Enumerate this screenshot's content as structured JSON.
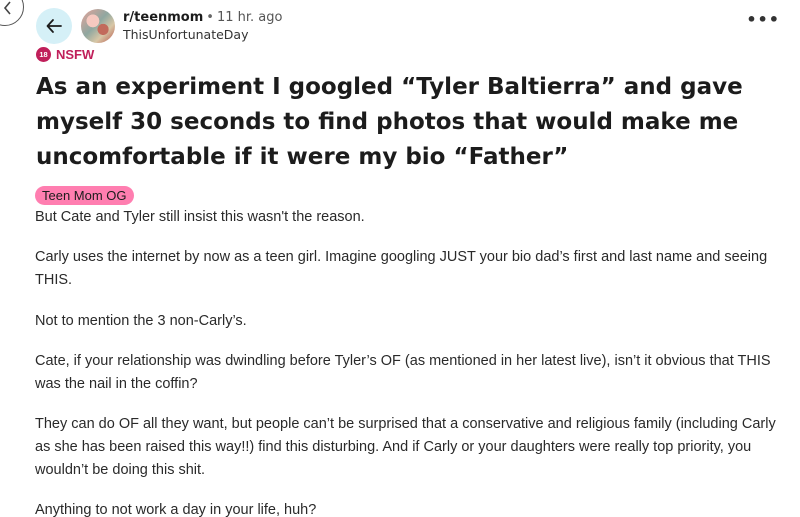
{
  "post": {
    "subreddit": "r/teenmom",
    "separator": "•",
    "time": "11 hr. ago",
    "username": "ThisUnfortunateDay",
    "nsfw_badge": "18",
    "nsfw_label": "NSFW",
    "title": "As an experiment I googled “Tyler Baltierra” and gave myself 30 seconds to find photos that would make me uncomfortable if it were my bio “Father”",
    "flair": "Teen Mom OG",
    "paragraphs": [
      "But Cate and Tyler still insist this wasn't the reason.",
      "Carly uses the internet by now as a teen girl. Imagine googling JUST your bio dad’s first and last name and seeing THIS.",
      "Not to mention the 3 non-Carly’s.",
      "Cate, if your relationship was dwindling before Tyler’s OF (as mentioned in her latest live), isn’t it obvious that THIS was the nail in the coffin?",
      "They can do OF all they want, but people can’t be surprised that a conservative and religious family (including Carly as she has been raised this way!!) find this disturbing. And if Carly or your daughters were really top priority, you wouldn’t be doing this shit.",
      "Anything to not work a day in your life, huh?"
    ],
    "more_menu": "•••"
  },
  "icons": {
    "back": "back-arrow-icon",
    "edge_back": "chevron-left-icon",
    "more": "more-options-icon"
  },
  "colors": {
    "back_button_bg": "#d5f0f7",
    "nsfw": "#c01f5a",
    "flair_bg": "#ff7eb0"
  }
}
